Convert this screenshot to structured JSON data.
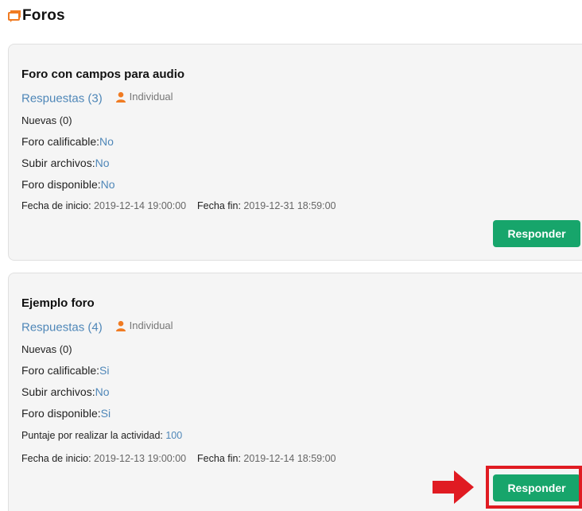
{
  "header": {
    "title": "Foros",
    "accent_color": "#f07b22"
  },
  "forums": [
    {
      "title": "Foro con campos para audio",
      "replies_label": "Respuestas (3)",
      "group_type": "Individual",
      "new_label": "Nuevas (0)",
      "gradable_label": "Foro calificable:",
      "gradable_value": "No",
      "upload_label": "Subir archivos:",
      "upload_value": "No",
      "available_label": "Foro disponible:",
      "available_value": "No",
      "start_label": "Fecha de inicio:",
      "start_value": "2019-12-14 19:00:00",
      "end_label": "Fecha fin:",
      "end_value": "2019-12-31 18:59:00",
      "button_label": "Responder"
    },
    {
      "title": "Ejemplo foro",
      "replies_label": "Respuestas (4)",
      "group_type": "Individual",
      "new_label": "Nuevas (0)",
      "gradable_label": "Foro calificable:",
      "gradable_value": "Si",
      "upload_label": "Subir archivos:",
      "upload_value": "No",
      "available_label": "Foro disponible:",
      "available_value": "Si",
      "score_label": "Puntaje por realizar la actividad:",
      "score_value": "100",
      "start_label": "Fecha de inicio:",
      "start_value": "2019-12-13 19:00:00",
      "end_label": "Fecha fin:",
      "end_value": "2019-12-14 18:59:00",
      "button_label": "Responder"
    }
  ],
  "colors": {
    "button_green": "#17a56b",
    "link_blue": "#4f87b8",
    "user_icon_orange": "#f07b22",
    "highlight_red": "#e01b22"
  },
  "icons": {
    "header_icon": "chat-bubble-icon",
    "group_icon": "user-icon",
    "annotation": "arrow-right-icon"
  }
}
